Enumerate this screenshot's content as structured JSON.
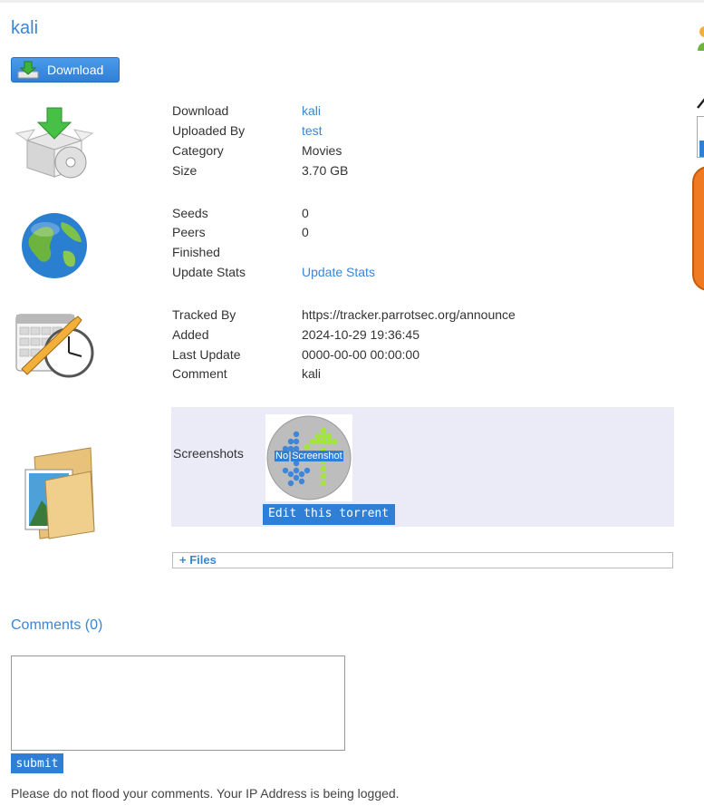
{
  "torrent": {
    "title": "kali",
    "download_button": "Download"
  },
  "info": {
    "download_label": "Download",
    "download_value": "kali",
    "uploaded_by_label": "Uploaded By",
    "uploaded_by_value": "test",
    "category_label": "Category",
    "category_value": "Movies",
    "size_label": "Size",
    "size_value": "3.70 GB"
  },
  "stats": {
    "seeds_label": "Seeds",
    "seeds_value": "0",
    "peers_label": "Peers",
    "peers_value": "0",
    "finished_label": "Finished",
    "update_label": "Update Stats",
    "update_link": "Update Stats"
  },
  "tracking": {
    "tracked_by_label": "Tracked By",
    "tracked_by_value": "https://tracker.parrotsec.org/announce",
    "added_label": "Added",
    "added_value": "2024-10-29 19:36:45",
    "last_update_label": "Last Update",
    "last_update_value": "0000-00-00 00:00:00",
    "comment_label": "Comment",
    "comment_value": "kali"
  },
  "screenshots": {
    "label": "Screenshots",
    "thumb_text_no": "No",
    "thumb_text_shot": "Screenshot",
    "edit_button": "Edit this torrent"
  },
  "files": {
    "toggle": "+ Files"
  },
  "comments": {
    "heading": "Comments (0)",
    "textarea_value": "",
    "submit": "submit",
    "notice": "Please do not flood your comments. Your IP Address is being logged."
  },
  "colors": {
    "accent": "#3a86d4",
    "button": "#2f7fd6",
    "screenshot_bg": "#ebebf8"
  }
}
